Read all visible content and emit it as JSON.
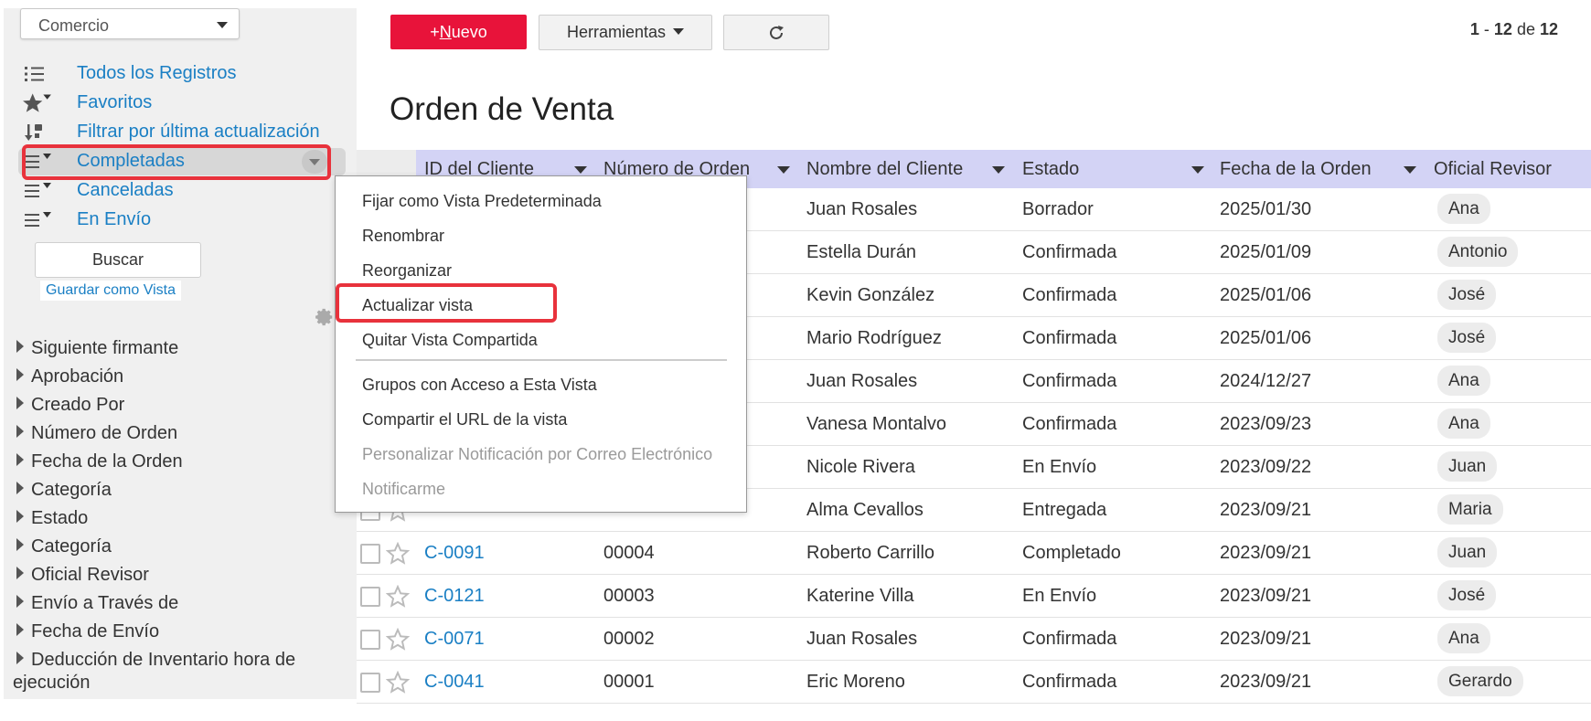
{
  "sidebar": {
    "app_select": {
      "value": "Comercio"
    },
    "views": [
      {
        "label": "Todos los Registros",
        "icon": "list-icon"
      },
      {
        "label": "Favoritos",
        "icon": "star-filter-icon"
      },
      {
        "label": "Filtrar por última actualización",
        "icon": "sort-updated-icon"
      },
      {
        "label": "Completadas",
        "icon": "list-filter-icon",
        "active": true
      },
      {
        "label": "Canceladas",
        "icon": "list-filter-icon"
      },
      {
        "label": "En Envío",
        "icon": "list-filter-icon"
      }
    ],
    "search_button": "Buscar",
    "save_view": "Guardar como Vista",
    "filters": [
      "Siguiente firmante",
      "Aprobación",
      "Creado Por",
      "Número de Orden",
      "Fecha de la Orden",
      "Categoría",
      "Estado",
      "Categoría",
      "Oficial Revisor",
      "Envío a Través de",
      "Fecha de Envío",
      "Deducción de Inventario hora de",
      "ejecución"
    ]
  },
  "toolbar": {
    "new_prefix": "+",
    "new_mnemonic": "N",
    "new_rest": "uevo",
    "tools_label": "Herramientas",
    "paging_from": "1",
    "paging_sep": " - ",
    "paging_to": "12",
    "paging_de": " de ",
    "paging_total": "12"
  },
  "page": {
    "title": "Orden de Venta"
  },
  "table": {
    "headers": [
      "ID del Cliente",
      "Número de Orden",
      "Nombre del Cliente",
      "Estado",
      "Fecha de la Orden",
      "Oficial Revisor"
    ],
    "rows": [
      {
        "id": "",
        "num": "",
        "name": "Juan Rosales",
        "state": "Borrador",
        "date": "2025/01/30",
        "officer": "Ana"
      },
      {
        "id": "",
        "num": "",
        "name": "Estella Durán",
        "state": "Confirmada",
        "date": "2025/01/09",
        "officer": "Antonio"
      },
      {
        "id": "",
        "num": "",
        "name": "Kevin González",
        "state": "Confirmada",
        "date": "2025/01/06",
        "officer": "José"
      },
      {
        "id": "",
        "num": "",
        "name": "Mario Rodríguez",
        "state": "Confirmada",
        "date": "2025/01/06",
        "officer": "José"
      },
      {
        "id": "",
        "num": "",
        "name": "Juan Rosales",
        "state": "Confirmada",
        "date": "2024/12/27",
        "officer": "Ana"
      },
      {
        "id": "",
        "num": "",
        "name": "Vanesa Montalvo",
        "state": "Confirmada",
        "date": "2023/09/23",
        "officer": "Ana"
      },
      {
        "id": "",
        "num": "",
        "name": "Nicole Rivera",
        "state": "En Envío",
        "date": "2023/09/22",
        "officer": "Juan"
      },
      {
        "id": "",
        "num": "",
        "name": "Alma Cevallos",
        "state": "Entregada",
        "date": "2023/09/21",
        "officer": "Maria"
      },
      {
        "id": "C-0091",
        "num": "00004",
        "name": "Roberto Carrillo",
        "state": "Completado",
        "date": "2023/09/21",
        "officer": "Juan"
      },
      {
        "id": "C-0121",
        "num": "00003",
        "name": "Katerine Villa",
        "state": "En Envío",
        "date": "2023/09/21",
        "officer": "José"
      },
      {
        "id": "C-0071",
        "num": "00002",
        "name": "Juan Rosales",
        "state": "Confirmada",
        "date": "2023/09/21",
        "officer": "Ana"
      },
      {
        "id": "C-0041",
        "num": "00001",
        "name": "Eric Moreno",
        "state": "Confirmada",
        "date": "2023/09/21",
        "officer": "Gerardo"
      }
    ]
  },
  "context_menu": {
    "items": [
      {
        "label": "Fijar como Vista Predeterminada",
        "disabled": false
      },
      {
        "label": "Renombrar",
        "disabled": false
      },
      {
        "label": "Reorganizar",
        "disabled": false
      },
      {
        "label": "Actualizar vista",
        "disabled": false,
        "highlighted": true
      },
      {
        "label": "Quitar Vista Compartida",
        "disabled": false
      },
      {
        "label": "Grupos con Acceso a Esta Vista",
        "disabled": false
      },
      {
        "label": "Compartir el URL de la vista",
        "disabled": false
      },
      {
        "label": "Personalizar Notificación por Correo Electrónico",
        "disabled": true
      },
      {
        "label": "Notificarme",
        "disabled": true
      }
    ]
  },
  "colors": {
    "accent": "#e8133a",
    "link": "#1a7fc4",
    "header_bg": "#d3d3f5",
    "highlight_outline": "#e8323c"
  }
}
